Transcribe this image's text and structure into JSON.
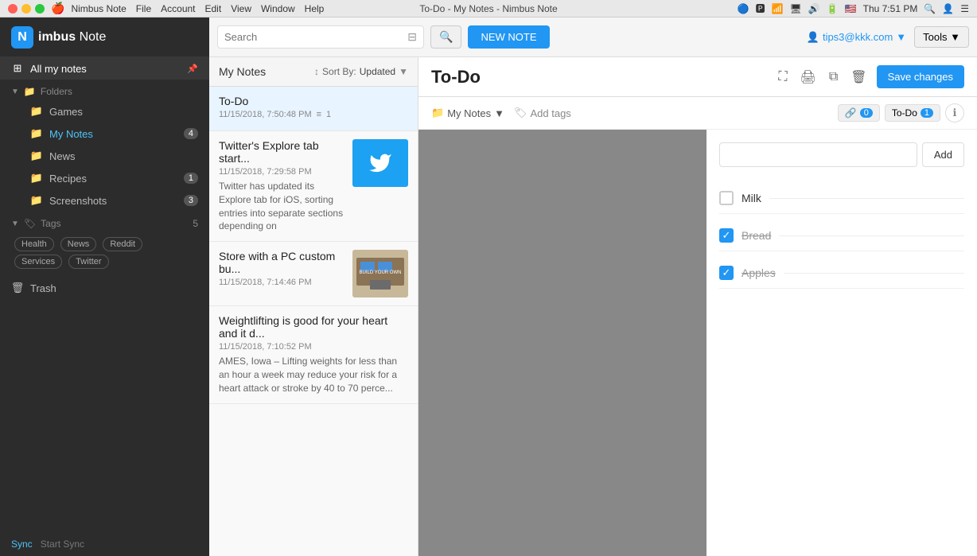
{
  "titlebar": {
    "window_title": "To-Do - My Notes - Nimbus Note",
    "app_name": "Nimbus Note",
    "menu": [
      "File",
      "Account",
      "Edit",
      "View",
      "Window",
      "Help"
    ],
    "time": "Thu 7:51 PM",
    "user_icon": "🌐"
  },
  "logo": {
    "letter": "N",
    "text_bold": "imbus",
    "text_light": " Note"
  },
  "sidebar": {
    "all_notes_label": "All my notes",
    "folders_label": "Folders",
    "folders": [
      {
        "name": "Games",
        "count": null
      },
      {
        "name": "My Notes",
        "count": 4
      },
      {
        "name": "News",
        "count": null
      },
      {
        "name": "Recipes",
        "count": 1
      },
      {
        "name": "Screenshots",
        "count": 3
      }
    ],
    "tags_label": "Tags",
    "tags_count": 5,
    "tags": [
      "Health",
      "News",
      "Reddit",
      "Services",
      "Twitter"
    ],
    "trash_label": "Trash",
    "sync_label": "Sync",
    "start_sync_label": "Start Sync"
  },
  "toolbar": {
    "search_placeholder": "Search",
    "new_note_label": "NEW NOTE",
    "user_email": "tips3@kkk.com",
    "tools_label": "Tools"
  },
  "notes_list": {
    "title": "My Notes",
    "sort_prefix": "Sort By:",
    "sort_value": "Updated",
    "notes": [
      {
        "title": "To-Do",
        "date": "11/15/2018, 7:50:48 PM",
        "list_icon": "≡",
        "count": "1",
        "active": true,
        "has_thumb": false
      },
      {
        "title": "Twitter's Explore tab start...",
        "date": "11/15/2018, 7:29:58 PM",
        "preview": "Twitter has updated its Explore tab for iOS, sorting entries into separate sections depending on",
        "has_thumb": true,
        "thumb_type": "twitter"
      },
      {
        "title": "Store with a PC custom bu...",
        "date": "11/15/2018, 7:14:46 PM",
        "preview": "",
        "has_thumb": true,
        "thumb_type": "store"
      },
      {
        "title": "Weightlifting is good for your heart and it d...",
        "date": "11/15/2018, 7:10:52 PM",
        "preview": "AMES, Iowa – Lifting weights for less than an hour a week may reduce your risk for a heart attack or stroke by 40 to 70 perce...",
        "has_thumb": false
      }
    ]
  },
  "editor": {
    "title": "To-Do",
    "folder": "My Notes",
    "add_tags_label": "Add tags",
    "link_count": "0",
    "tag_label": "To-Do",
    "tag_count": "1",
    "save_label": "Save changes",
    "add_input_placeholder": "",
    "add_btn_label": "Add",
    "todos": [
      {
        "text": "Milk",
        "done": false
      },
      {
        "text": "Bread",
        "done": true
      },
      {
        "text": "Apples",
        "done": true
      }
    ]
  }
}
